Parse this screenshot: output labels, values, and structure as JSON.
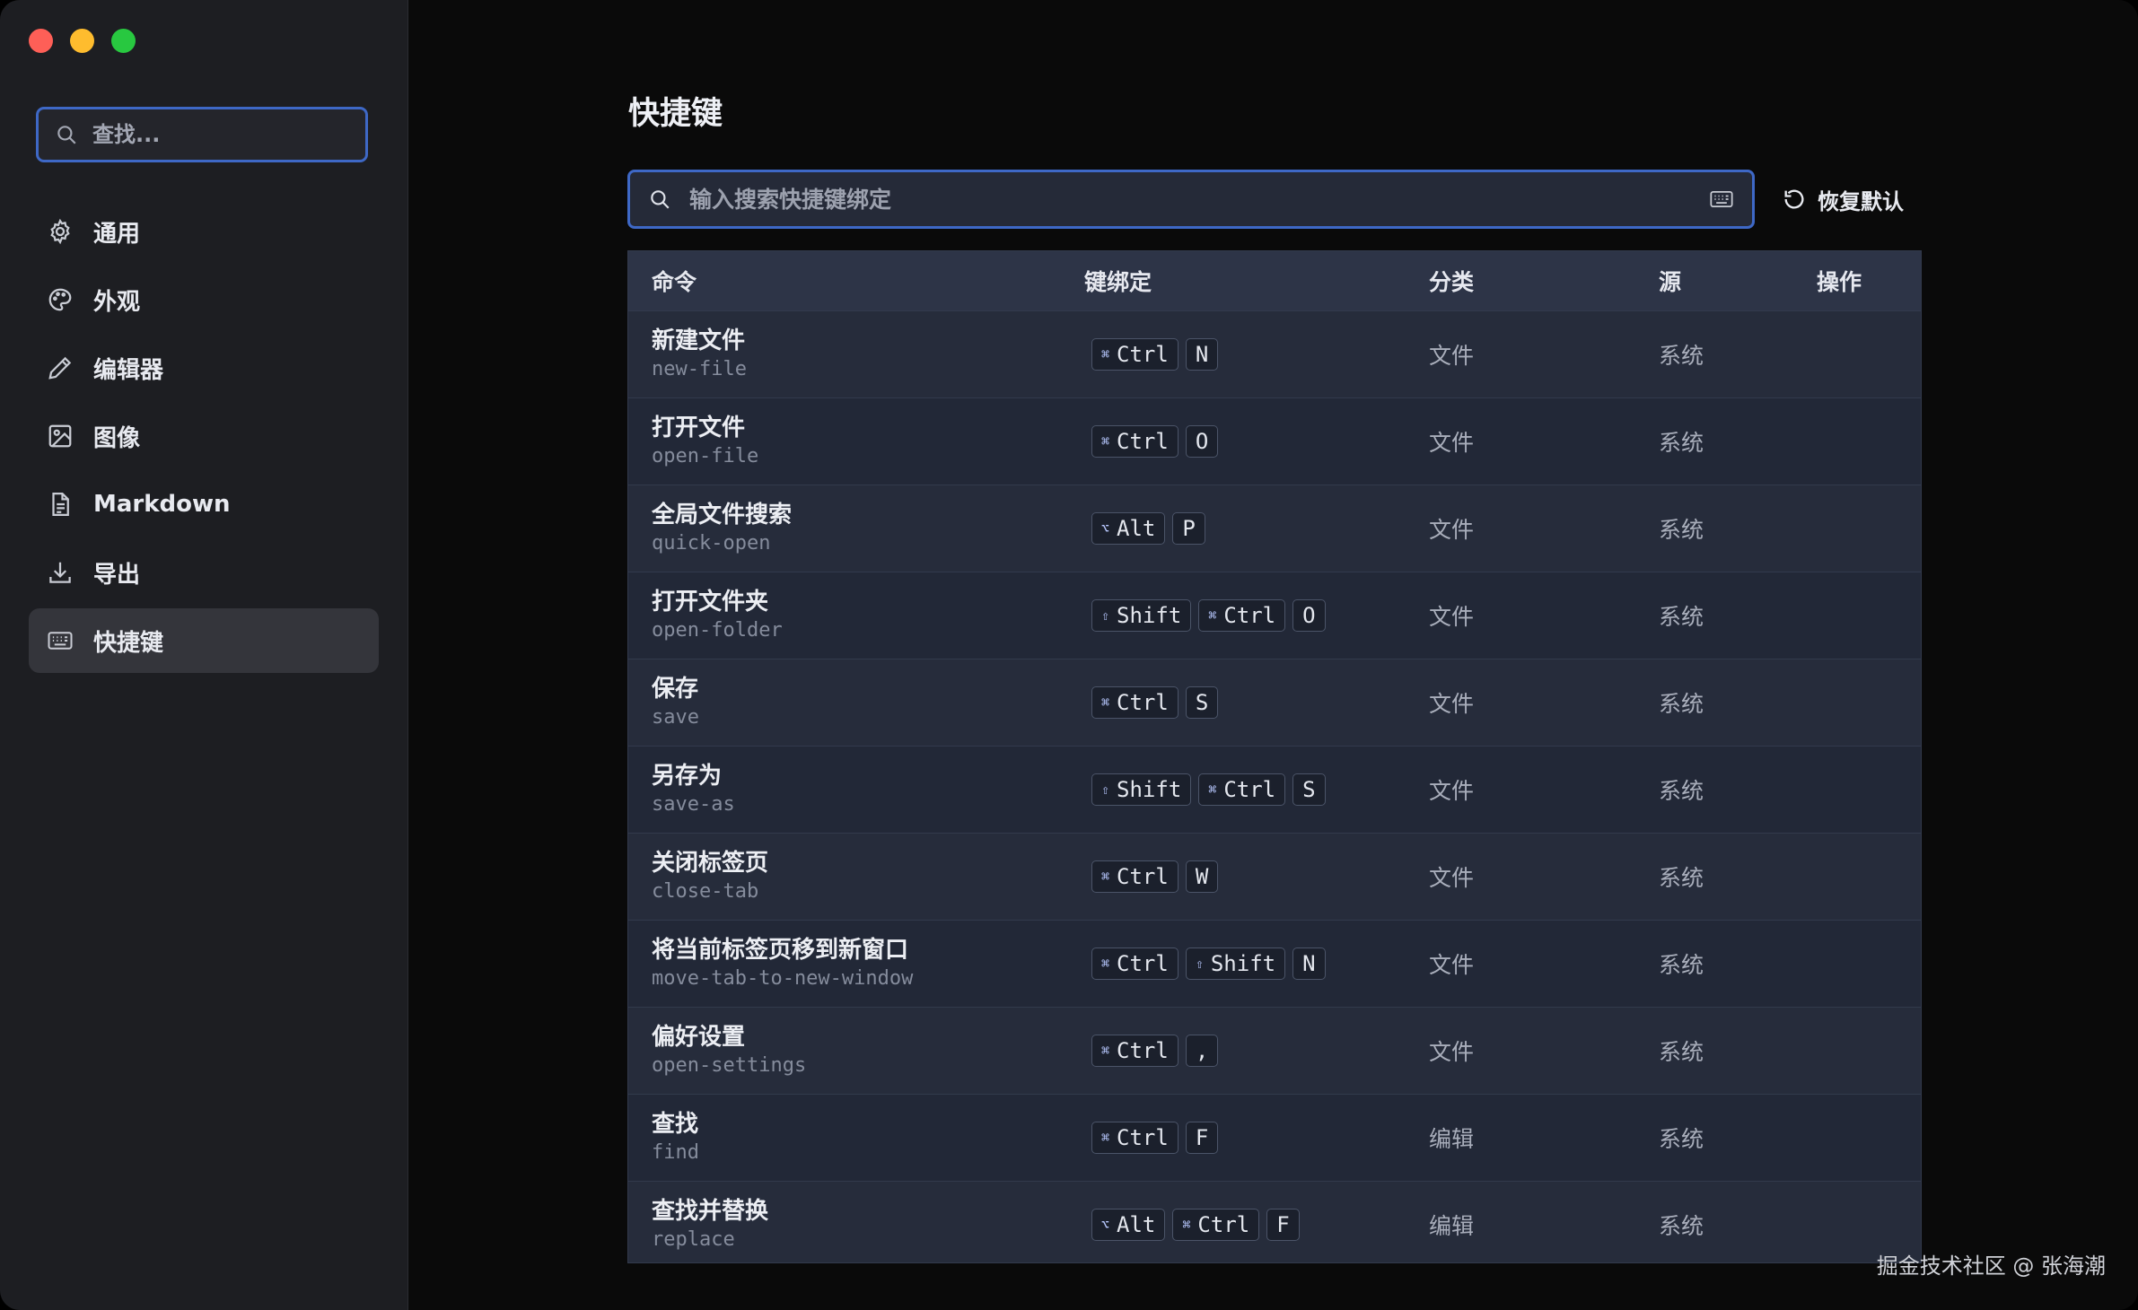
{
  "sidebar": {
    "search_placeholder": "查找...",
    "items": [
      {
        "label": "通用",
        "icon": "gear-icon"
      },
      {
        "label": "外观",
        "icon": "palette-icon"
      },
      {
        "label": "编辑器",
        "icon": "pencil-icon"
      },
      {
        "label": "图像",
        "icon": "image-icon"
      },
      {
        "label": "Markdown",
        "icon": "document-icon"
      },
      {
        "label": "导出",
        "icon": "download-icon"
      },
      {
        "label": "快捷键",
        "icon": "keyboard-icon",
        "active": true
      }
    ]
  },
  "main": {
    "title": "快捷键",
    "search_placeholder": "输入搜索快捷键绑定",
    "reset_label": "恢复默认",
    "columns": [
      "命令",
      "键绑定",
      "分类",
      "源",
      "操作"
    ],
    "rows": [
      {
        "name": "新建文件",
        "id": "new-file",
        "keys": [
          {
            "sym": "⌘",
            "k": "Ctrl"
          },
          {
            "k": "N"
          }
        ],
        "category": "文件",
        "source": "系统"
      },
      {
        "name": "打开文件",
        "id": "open-file",
        "keys": [
          {
            "sym": "⌘",
            "k": "Ctrl"
          },
          {
            "k": "O"
          }
        ],
        "category": "文件",
        "source": "系统"
      },
      {
        "name": "全局文件搜索",
        "id": "quick-open",
        "keys": [
          {
            "sym": "⌥",
            "k": "Alt"
          },
          {
            "k": "P"
          }
        ],
        "category": "文件",
        "source": "系统"
      },
      {
        "name": "打开文件夹",
        "id": "open-folder",
        "keys": [
          {
            "sym": "⇧",
            "k": "Shift"
          },
          {
            "sym": "⌘",
            "k": "Ctrl"
          },
          {
            "k": "O"
          }
        ],
        "category": "文件",
        "source": "系统"
      },
      {
        "name": "保存",
        "id": "save",
        "keys": [
          {
            "sym": "⌘",
            "k": "Ctrl"
          },
          {
            "k": "S"
          }
        ],
        "category": "文件",
        "source": "系统"
      },
      {
        "name": "另存为",
        "id": "save-as",
        "keys": [
          {
            "sym": "⇧",
            "k": "Shift"
          },
          {
            "sym": "⌘",
            "k": "Ctrl"
          },
          {
            "k": "S"
          }
        ],
        "category": "文件",
        "source": "系统"
      },
      {
        "name": "关闭标签页",
        "id": "close-tab",
        "keys": [
          {
            "sym": "⌘",
            "k": "Ctrl"
          },
          {
            "k": "W"
          }
        ],
        "category": "文件",
        "source": "系统"
      },
      {
        "name": "将当前标签页移到新窗口",
        "id": "move-tab-to-new-window",
        "keys": [
          {
            "sym": "⌘",
            "k": "Ctrl"
          },
          {
            "sym": "⇧",
            "k": "Shift"
          },
          {
            "k": "N"
          }
        ],
        "category": "文件",
        "source": "系统"
      },
      {
        "name": "偏好设置",
        "id": "open-settings",
        "keys": [
          {
            "sym": "⌘",
            "k": "Ctrl"
          },
          {
            "k": ","
          }
        ],
        "category": "文件",
        "source": "系统"
      },
      {
        "name": "查找",
        "id": "find",
        "keys": [
          {
            "sym": "⌘",
            "k": "Ctrl"
          },
          {
            "k": "F"
          }
        ],
        "category": "编辑",
        "source": "系统"
      },
      {
        "name": "查找并替换",
        "id": "replace",
        "keys": [
          {
            "sym": "⌥",
            "k": "Alt"
          },
          {
            "sym": "⌘",
            "k": "Ctrl"
          },
          {
            "k": "F"
          }
        ],
        "category": "编辑",
        "source": "系统"
      }
    ]
  },
  "watermark": "掘金技术社区 @ 张海潮",
  "colors": {
    "accent": "#3e68c6",
    "close": "#fe5f57",
    "minimize": "#febc2e",
    "zoom": "#28c840"
  }
}
